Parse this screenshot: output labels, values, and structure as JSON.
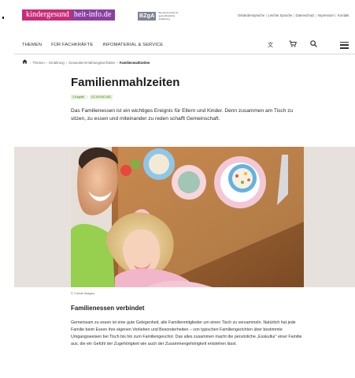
{
  "topbar": {
    "logo_part1": "kindergesund",
    "logo_part2": "heit-info.de",
    "agency_mark": "BZgA",
    "agency_sub": "Bundeszentrale für gesundheitliche Aufklärung",
    "links": [
      "Gebärdensprache",
      "Leichte Sprache",
      "Datenschutz",
      "Impressum",
      "Kontakt"
    ]
  },
  "nav": {
    "items": [
      "THEMEN",
      "FÜR FACHKRÄFTE",
      "INFOMATERIAL & SERVICE"
    ],
    "icons": [
      "translate-icon",
      "cart-icon",
      "search-icon",
      "menu-icon"
    ]
  },
  "breadcrumb": {
    "items": [
      "Themen",
      "Ernährung",
      "Gesundes Ernährungsverhalten",
      "Familienmahlzeiten"
    ]
  },
  "article": {
    "title": "Familienmahlzeiten",
    "tags": [
      "1 Kapitel",
      "CC BY-NC-ND"
    ],
    "intro": "Das Familienessen ist ein wichtiges Ereignis für Eltern und Kinder. Denn zusammen am Tisch zu sitzen, zu essen und miteinander zu reden schafft Gemeinschaft.",
    "image_credit": "© Corbis Images",
    "section_title": "Familienessen verbindet",
    "section_body": "Gemeinsam zu essen ist eine gute Gelegenheit, alle Familienmitglieder um einen Tisch zu versammeln. Natürlich hat jede Familie beim Essen ihre eigenen Vorlieben und Besonderheiten – von typischen Familiengerichten über bestimmte Umgangsweisen bei Tisch bis hin zum Familiengeschirr. Das alles zusammen macht die persönliche „Esskultur“ einer Familie aus, die ein Gefühl der Zugehörigkeit wie auch der Zusammengehörigkeit entstehen lässt."
  },
  "colors": {
    "brand_pink": "#c72c78",
    "brand_purple": "#8c3fa0",
    "tag_green": "#3a7d23",
    "hero_bg": "#e6e1dc"
  }
}
